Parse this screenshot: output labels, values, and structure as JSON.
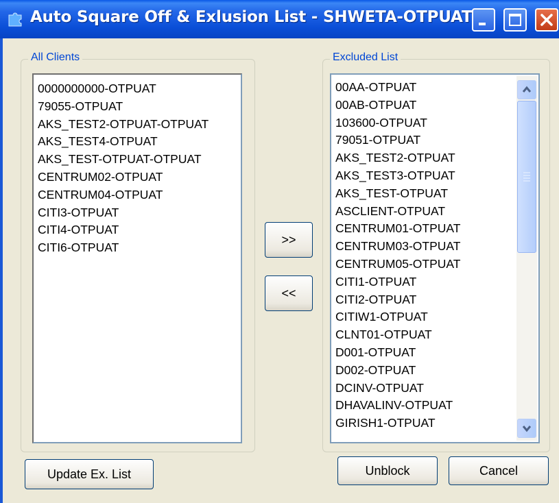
{
  "window": {
    "title": "Auto Square Off & Exlusion List - SHWETA-OTPUAT",
    "colors": {
      "titlebar": "#0b4fd8",
      "legend": "#0046d5",
      "face": "#ece9d8"
    }
  },
  "all_clients": {
    "label": "All Clients",
    "items": [
      "0000000000-OTPUAT",
      "79055-OTPUAT",
      "AKS_TEST2-OTPUAT-OTPUAT",
      "AKS_TEST4-OTPUAT",
      "AKS_TEST-OTPUAT-OTPUAT",
      "CENTRUM02-OTPUAT",
      "CENTRUM04-OTPUAT",
      "CITI3-OTPUAT",
      "CITI4-OTPUAT",
      "CITI6-OTPUAT"
    ]
  },
  "excluded": {
    "label": "Excluded List",
    "items": [
      "00AA-OTPUAT",
      "00AB-OTPUAT",
      "103600-OTPUAT",
      "79051-OTPUAT",
      "AKS_TEST2-OTPUAT",
      "AKS_TEST3-OTPUAT",
      "AKS_TEST-OTPUAT",
      "ASCLIENT-OTPUAT",
      "CENTRUM01-OTPUAT",
      "CENTRUM03-OTPUAT",
      "CENTRUM05-OTPUAT",
      "CITI1-OTPUAT",
      "CITI2-OTPUAT",
      "CITIW1-OTPUAT",
      "CLNT01-OTPUAT",
      "D001-OTPUAT",
      "D002-OTPUAT",
      "DCINV-OTPUAT",
      "DHAVALINV-OTPUAT",
      "GIRISH1-OTPUAT"
    ]
  },
  "buttons": {
    "move_right": ">>",
    "move_left": "<<",
    "update": "Update Ex. List",
    "unblock": "Unblock",
    "cancel": "Cancel"
  }
}
